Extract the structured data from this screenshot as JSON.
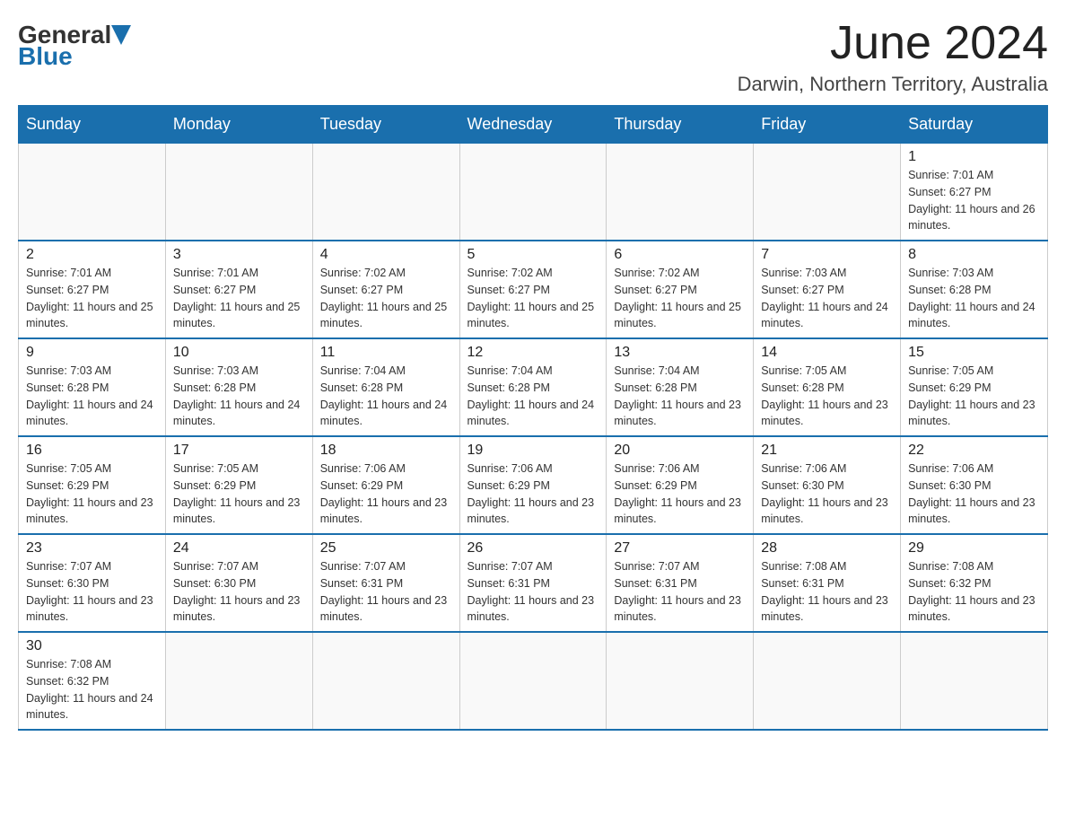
{
  "header": {
    "logo_general": "General",
    "logo_blue": "Blue",
    "month_title": "June 2024",
    "location": "Darwin, Northern Territory, Australia"
  },
  "weekdays": [
    "Sunday",
    "Monday",
    "Tuesday",
    "Wednesday",
    "Thursday",
    "Friday",
    "Saturday"
  ],
  "weeks": [
    [
      {
        "day": "",
        "sunrise": "",
        "sunset": "",
        "daylight": ""
      },
      {
        "day": "",
        "sunrise": "",
        "sunset": "",
        "daylight": ""
      },
      {
        "day": "",
        "sunrise": "",
        "sunset": "",
        "daylight": ""
      },
      {
        "day": "",
        "sunrise": "",
        "sunset": "",
        "daylight": ""
      },
      {
        "day": "",
        "sunrise": "",
        "sunset": "",
        "daylight": ""
      },
      {
        "day": "",
        "sunrise": "",
        "sunset": "",
        "daylight": ""
      },
      {
        "day": "1",
        "sunrise": "Sunrise: 7:01 AM",
        "sunset": "Sunset: 6:27 PM",
        "daylight": "Daylight: 11 hours and 26 minutes."
      }
    ],
    [
      {
        "day": "2",
        "sunrise": "Sunrise: 7:01 AM",
        "sunset": "Sunset: 6:27 PM",
        "daylight": "Daylight: 11 hours and 25 minutes."
      },
      {
        "day": "3",
        "sunrise": "Sunrise: 7:01 AM",
        "sunset": "Sunset: 6:27 PM",
        "daylight": "Daylight: 11 hours and 25 minutes."
      },
      {
        "day": "4",
        "sunrise": "Sunrise: 7:02 AM",
        "sunset": "Sunset: 6:27 PM",
        "daylight": "Daylight: 11 hours and 25 minutes."
      },
      {
        "day": "5",
        "sunrise": "Sunrise: 7:02 AM",
        "sunset": "Sunset: 6:27 PM",
        "daylight": "Daylight: 11 hours and 25 minutes."
      },
      {
        "day": "6",
        "sunrise": "Sunrise: 7:02 AM",
        "sunset": "Sunset: 6:27 PM",
        "daylight": "Daylight: 11 hours and 25 minutes."
      },
      {
        "day": "7",
        "sunrise": "Sunrise: 7:03 AM",
        "sunset": "Sunset: 6:27 PM",
        "daylight": "Daylight: 11 hours and 24 minutes."
      },
      {
        "day": "8",
        "sunrise": "Sunrise: 7:03 AM",
        "sunset": "Sunset: 6:28 PM",
        "daylight": "Daylight: 11 hours and 24 minutes."
      }
    ],
    [
      {
        "day": "9",
        "sunrise": "Sunrise: 7:03 AM",
        "sunset": "Sunset: 6:28 PM",
        "daylight": "Daylight: 11 hours and 24 minutes."
      },
      {
        "day": "10",
        "sunrise": "Sunrise: 7:03 AM",
        "sunset": "Sunset: 6:28 PM",
        "daylight": "Daylight: 11 hours and 24 minutes."
      },
      {
        "day": "11",
        "sunrise": "Sunrise: 7:04 AM",
        "sunset": "Sunset: 6:28 PM",
        "daylight": "Daylight: 11 hours and 24 minutes."
      },
      {
        "day": "12",
        "sunrise": "Sunrise: 7:04 AM",
        "sunset": "Sunset: 6:28 PM",
        "daylight": "Daylight: 11 hours and 24 minutes."
      },
      {
        "day": "13",
        "sunrise": "Sunrise: 7:04 AM",
        "sunset": "Sunset: 6:28 PM",
        "daylight": "Daylight: 11 hours and 23 minutes."
      },
      {
        "day": "14",
        "sunrise": "Sunrise: 7:05 AM",
        "sunset": "Sunset: 6:28 PM",
        "daylight": "Daylight: 11 hours and 23 minutes."
      },
      {
        "day": "15",
        "sunrise": "Sunrise: 7:05 AM",
        "sunset": "Sunset: 6:29 PM",
        "daylight": "Daylight: 11 hours and 23 minutes."
      }
    ],
    [
      {
        "day": "16",
        "sunrise": "Sunrise: 7:05 AM",
        "sunset": "Sunset: 6:29 PM",
        "daylight": "Daylight: 11 hours and 23 minutes."
      },
      {
        "day": "17",
        "sunrise": "Sunrise: 7:05 AM",
        "sunset": "Sunset: 6:29 PM",
        "daylight": "Daylight: 11 hours and 23 minutes."
      },
      {
        "day": "18",
        "sunrise": "Sunrise: 7:06 AM",
        "sunset": "Sunset: 6:29 PM",
        "daylight": "Daylight: 11 hours and 23 minutes."
      },
      {
        "day": "19",
        "sunrise": "Sunrise: 7:06 AM",
        "sunset": "Sunset: 6:29 PM",
        "daylight": "Daylight: 11 hours and 23 minutes."
      },
      {
        "day": "20",
        "sunrise": "Sunrise: 7:06 AM",
        "sunset": "Sunset: 6:29 PM",
        "daylight": "Daylight: 11 hours and 23 minutes."
      },
      {
        "day": "21",
        "sunrise": "Sunrise: 7:06 AM",
        "sunset": "Sunset: 6:30 PM",
        "daylight": "Daylight: 11 hours and 23 minutes."
      },
      {
        "day": "22",
        "sunrise": "Sunrise: 7:06 AM",
        "sunset": "Sunset: 6:30 PM",
        "daylight": "Daylight: 11 hours and 23 minutes."
      }
    ],
    [
      {
        "day": "23",
        "sunrise": "Sunrise: 7:07 AM",
        "sunset": "Sunset: 6:30 PM",
        "daylight": "Daylight: 11 hours and 23 minutes."
      },
      {
        "day": "24",
        "sunrise": "Sunrise: 7:07 AM",
        "sunset": "Sunset: 6:30 PM",
        "daylight": "Daylight: 11 hours and 23 minutes."
      },
      {
        "day": "25",
        "sunrise": "Sunrise: 7:07 AM",
        "sunset": "Sunset: 6:31 PM",
        "daylight": "Daylight: 11 hours and 23 minutes."
      },
      {
        "day": "26",
        "sunrise": "Sunrise: 7:07 AM",
        "sunset": "Sunset: 6:31 PM",
        "daylight": "Daylight: 11 hours and 23 minutes."
      },
      {
        "day": "27",
        "sunrise": "Sunrise: 7:07 AM",
        "sunset": "Sunset: 6:31 PM",
        "daylight": "Daylight: 11 hours and 23 minutes."
      },
      {
        "day": "28",
        "sunrise": "Sunrise: 7:08 AM",
        "sunset": "Sunset: 6:31 PM",
        "daylight": "Daylight: 11 hours and 23 minutes."
      },
      {
        "day": "29",
        "sunrise": "Sunrise: 7:08 AM",
        "sunset": "Sunset: 6:32 PM",
        "daylight": "Daylight: 11 hours and 23 minutes."
      }
    ],
    [
      {
        "day": "30",
        "sunrise": "Sunrise: 7:08 AM",
        "sunset": "Sunset: 6:32 PM",
        "daylight": "Daylight: 11 hours and 24 minutes."
      },
      {
        "day": "",
        "sunrise": "",
        "sunset": "",
        "daylight": ""
      },
      {
        "day": "",
        "sunrise": "",
        "sunset": "",
        "daylight": ""
      },
      {
        "day": "",
        "sunrise": "",
        "sunset": "",
        "daylight": ""
      },
      {
        "day": "",
        "sunrise": "",
        "sunset": "",
        "daylight": ""
      },
      {
        "day": "",
        "sunrise": "",
        "sunset": "",
        "daylight": ""
      },
      {
        "day": "",
        "sunrise": "",
        "sunset": "",
        "daylight": ""
      }
    ]
  ]
}
